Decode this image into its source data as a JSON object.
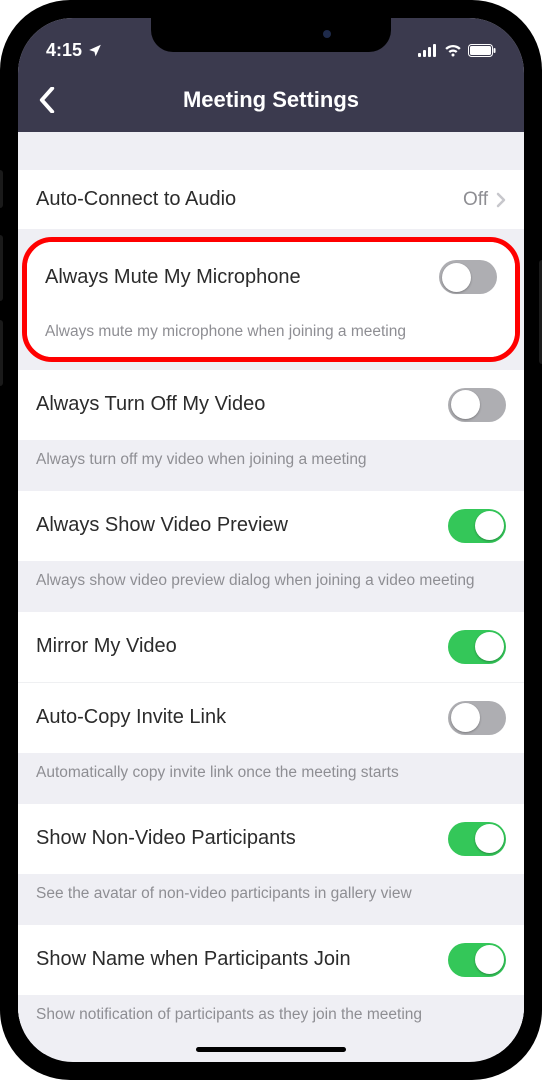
{
  "status": {
    "time": "4:15",
    "location_icon": "location-arrow-icon"
  },
  "nav": {
    "title": "Meeting Settings"
  },
  "rows": {
    "auto_connect": {
      "title": "Auto-Connect to Audio",
      "value": "Off"
    },
    "mute_mic": {
      "title": "Always Mute My Microphone",
      "footer": "Always mute my microphone when joining a meeting"
    },
    "off_video": {
      "title": "Always Turn Off My Video",
      "footer": "Always turn off my video when joining a meeting"
    },
    "preview": {
      "title": "Always Show Video Preview",
      "footer": "Always show video preview dialog when joining a video meeting"
    },
    "mirror": {
      "title": "Mirror My Video"
    },
    "copy_link": {
      "title": "Auto-Copy Invite Link",
      "footer": "Automatically copy invite link once the meeting starts"
    },
    "nonvideo": {
      "title": "Show Non-Video Participants",
      "footer": "See the avatar of non-video participants in gallery view"
    },
    "show_name": {
      "title": "Show Name when Participants Join",
      "footer": "Show notification of participants as they join the meeting"
    }
  },
  "toggles": {
    "mute_mic": false,
    "off_video": false,
    "preview": true,
    "mirror": true,
    "copy_link": false,
    "nonvideo": true,
    "show_name": true
  }
}
